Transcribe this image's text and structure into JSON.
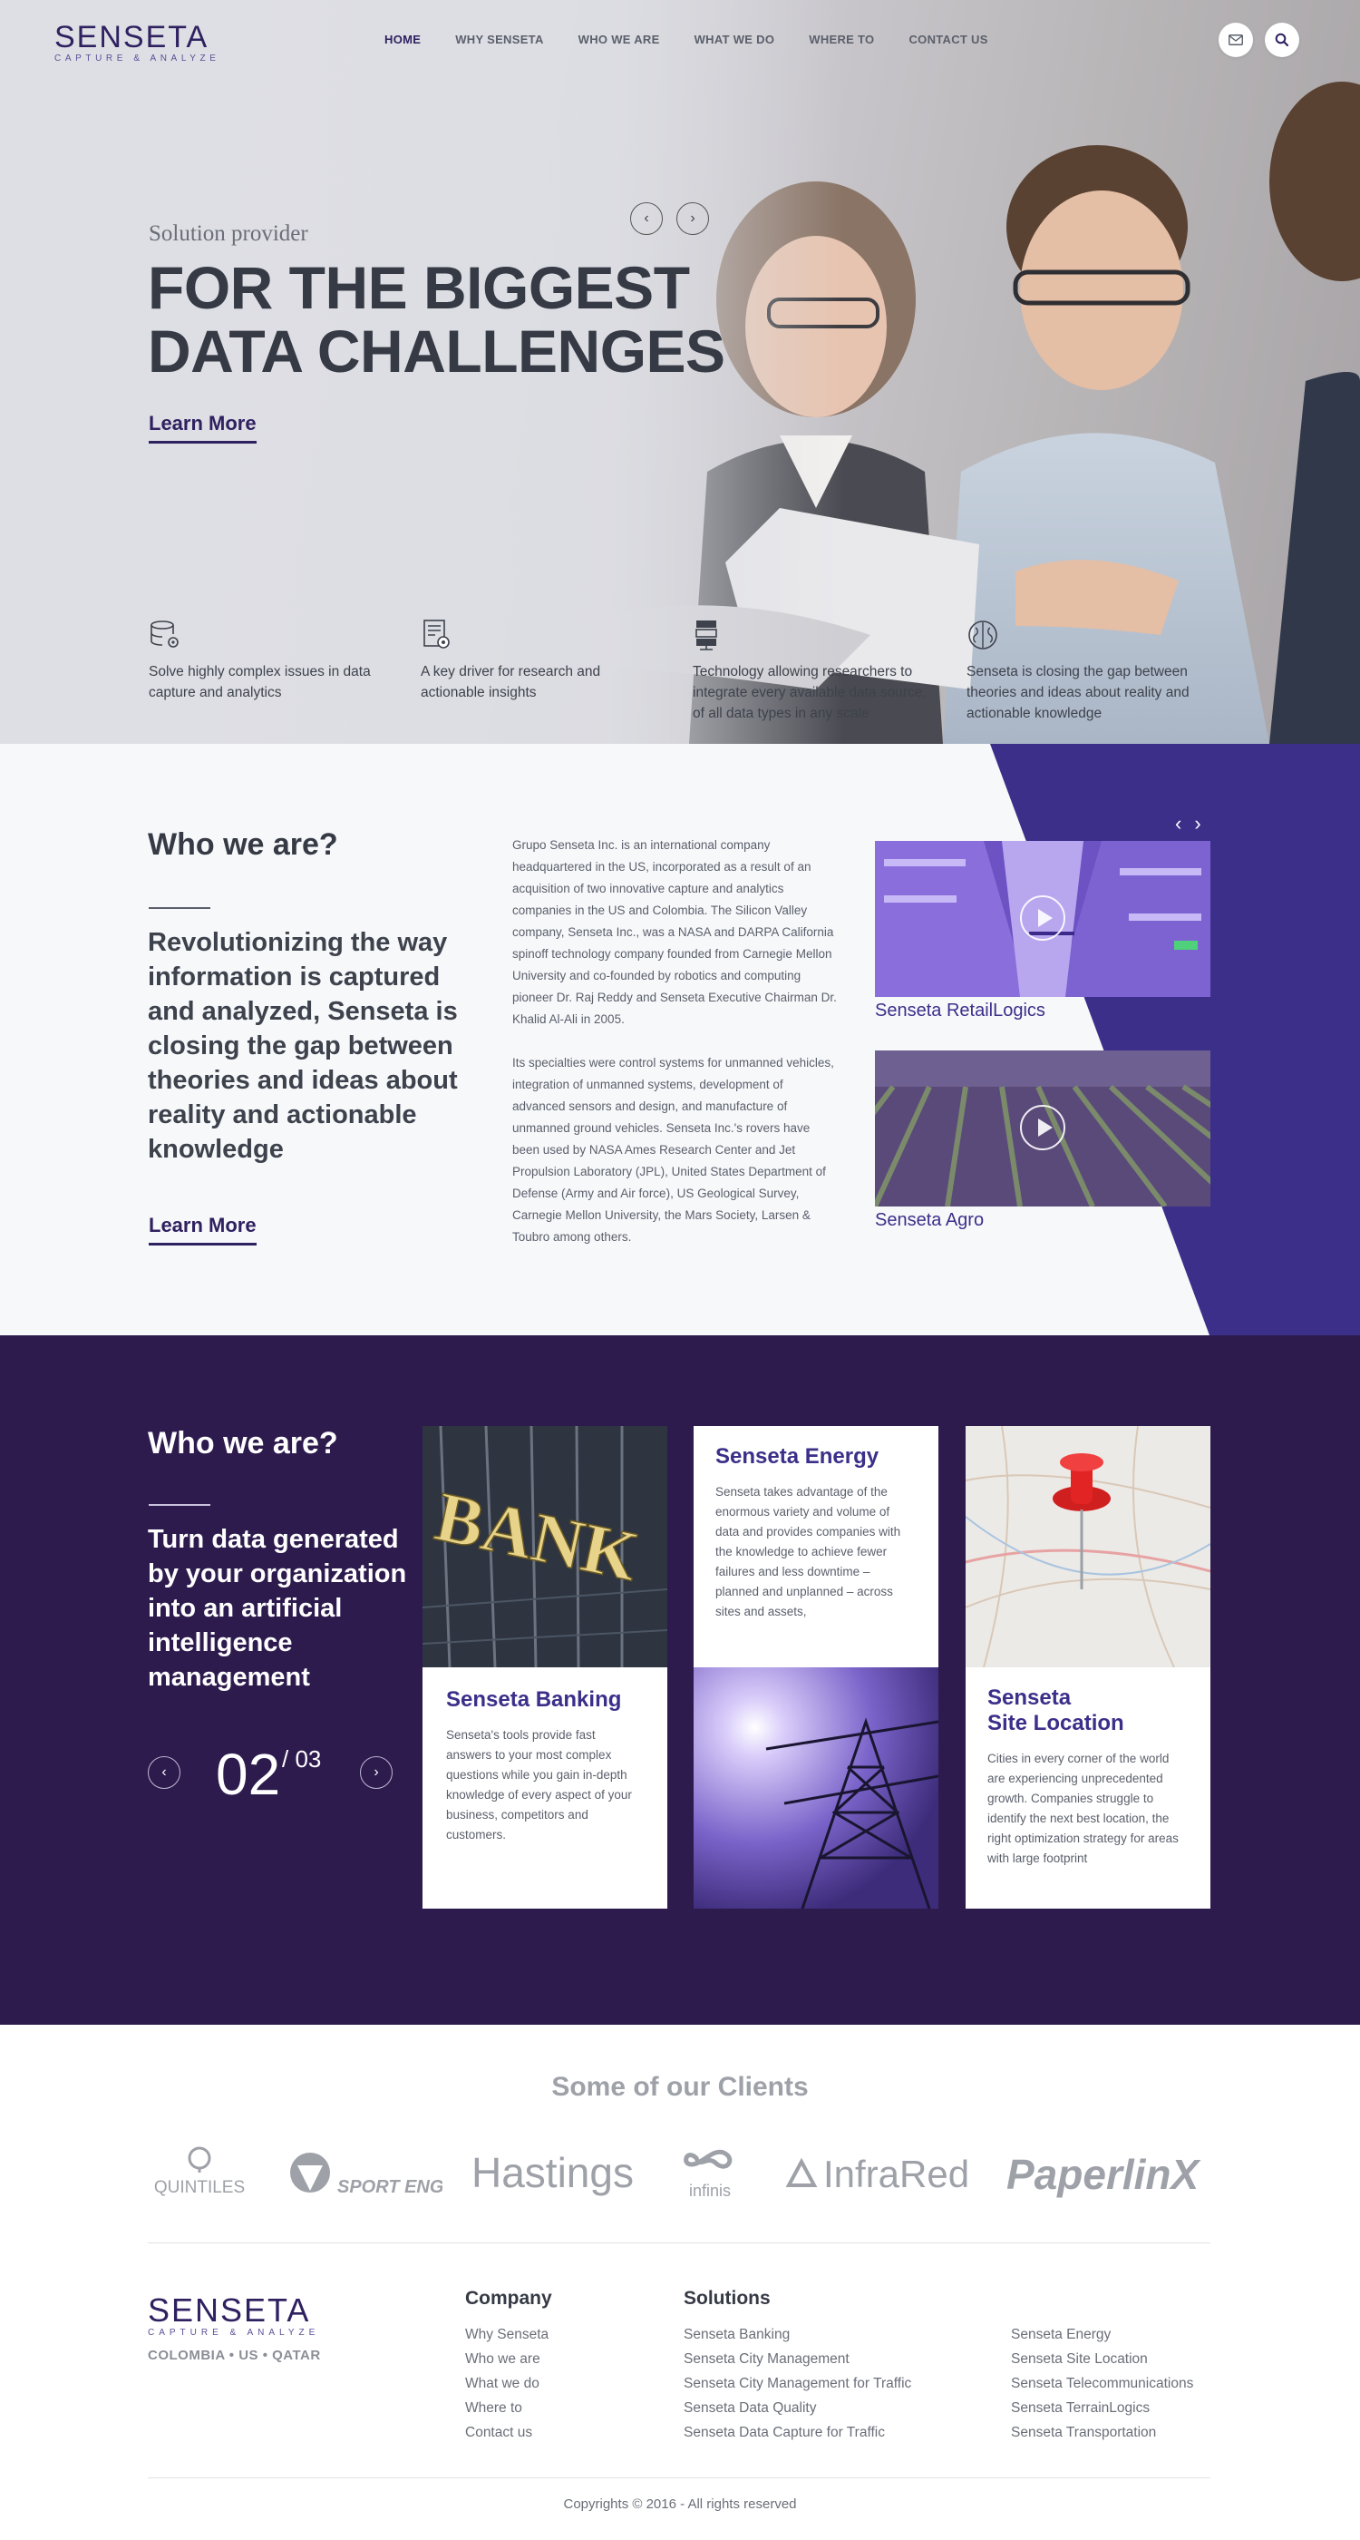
{
  "brand": {
    "name": "SENSETA",
    "tagline": "CAPTURE & ANALYZE",
    "accent": "#2f2160",
    "purple_bg": "#2d1b4e",
    "band": "#3b2f8a"
  },
  "nav": {
    "items": [
      "HOME",
      "WHY SENSETA",
      "WHO WE ARE",
      "WHAT WE DO",
      "WHERE TO",
      "CONTACT US"
    ],
    "active": "HOME",
    "icons": [
      "mail-icon",
      "search-icon"
    ]
  },
  "hero": {
    "subtitle": "Solution provider",
    "title_line1": "FOR THE BIGGEST",
    "title_line2": "DATA CHALLENGES",
    "cta": "Learn More",
    "features": [
      {
        "icon": "database-gear-icon",
        "text": "Solve highly complex issues in data capture and analytics"
      },
      {
        "icon": "document-gear-icon",
        "text": "A key driver for research and actionable insights"
      },
      {
        "icon": "server-icon",
        "text": "Technology allowing researchers to integrate every available data source, of all data types in any scale"
      },
      {
        "icon": "brain-icon",
        "text": "Senseta is closing the gap between theories and ideas about reality and actionable knowledge"
      }
    ]
  },
  "who": {
    "heading": "Who we are?",
    "lead": "Revolutionizing the way information is captured and analyzed, Senseta is closing the gap between theories and ideas about reality and actionable knowledge",
    "cta": "Learn More",
    "para1": "Grupo Senseta Inc. is an international company headquartered in the US, incorporated as a result of an acquisition of two innovative capture and analytics companies in the US and Colombia. The Silicon Valley company, Senseta Inc., was a NASA and DARPA California spinoff technology company founded from Carnegie Mellon University and co-founded by robotics and computing pioneer Dr. Raj Reddy and Senseta Executive Chairman Dr. Khalid Al-Ali in 2005.",
    "para2": "Its specialties were control systems for unmanned vehicles, integration of unmanned systems, development of advanced sensors and design, and manufacture of unmanned ground vehicles. Senseta Inc.'s rovers have been used by NASA Ames Research Center and Jet Propulsion Laboratory (JPL), United States Department of Defense (Army and Air force), US Geological Survey, Carnegie Mellon University, the Mars Society, Larsen & Toubro among others.",
    "videos": [
      {
        "caption": "Senseta RetailLogics"
      },
      {
        "caption": "Senseta Agro"
      }
    ]
  },
  "solutions": {
    "heading": "Who we are?",
    "lead": "Turn data generated by your organization into an artificial intelligence management",
    "pager": {
      "current": "02",
      "total": "/ 03"
    },
    "banking": {
      "title": "Senseta Banking",
      "text": "Senseta's tools provide fast answers to your most complex questions while you gain in-depth knowledge of every aspect of your business, competitors and customers."
    },
    "energy": {
      "title": "Senseta Energy",
      "text": "Senseta takes advantage of the enormous variety and volume of data and provides companies  with the knowledge to achieve fewer failures and less downtime – planned and unplanned – across sites and assets,"
    },
    "site": {
      "title_line1": "Senseta",
      "title_line2": "Site Location",
      "text": "Cities in every corner of the world are experiencing unprecedented growth. Companies struggle to identify the next best location, the right optimization strategy for areas with large footprint"
    },
    "bank_sign": "BANK"
  },
  "clients": {
    "title": "Some of our Clients",
    "logos": [
      "QUINTILES",
      "SPORT ENGLAND",
      "Hastings",
      "infinis",
      "InfraRed",
      "PaperlinX"
    ]
  },
  "footer": {
    "logo": "SENSETA",
    "tagline": "CAPTURE & ANALYZE",
    "locations": "COLOMBIA • US • QATAR",
    "company": {
      "title": "Company",
      "links": [
        "Why Senseta",
        "Who we are",
        "What we do",
        "Where to",
        "Contact us"
      ]
    },
    "solutions": {
      "title": "Solutions",
      "col1": [
        "Senseta Banking",
        "Senseta City Management",
        "Senseta City Management for Traffic",
        "Senseta Data Quality",
        "Senseta Data Capture for Traffic"
      ],
      "col2": [
        "Senseta Energy",
        "Senseta Site Location",
        "Senseta Telecommunications",
        "Senseta TerrainLogics",
        "Senseta Transportation"
      ]
    },
    "copyright": "Copyrights © 2016 - All rights reserved"
  }
}
